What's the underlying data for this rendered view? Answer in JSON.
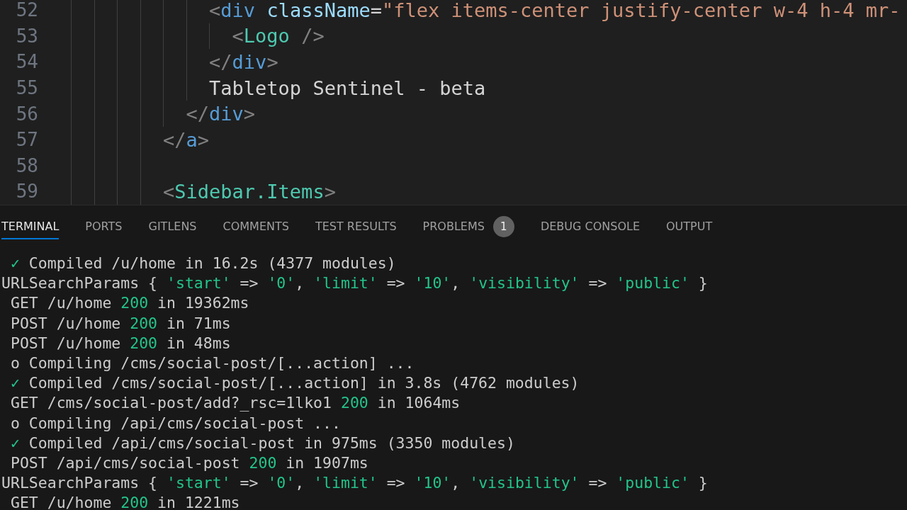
{
  "editor": {
    "lines": [
      {
        "number": "52",
        "tokens": [
          {
            "kind": "bracket",
            "text": "            <"
          },
          {
            "kind": "tag",
            "text": "div"
          },
          {
            "kind": "attr",
            "text": " className"
          },
          {
            "kind": "text",
            "text": "="
          },
          {
            "kind": "string",
            "text": "\"flex items-center justify-center w-4 h-4 mr-"
          }
        ]
      },
      {
        "number": "53",
        "tokens": [
          {
            "kind": "bracket",
            "text": "              <"
          },
          {
            "kind": "component",
            "text": "Logo"
          },
          {
            "kind": "bracket",
            "text": " />"
          }
        ]
      },
      {
        "number": "54",
        "tokens": [
          {
            "kind": "bracket",
            "text": "            </"
          },
          {
            "kind": "tag",
            "text": "div"
          },
          {
            "kind": "bracket",
            "text": ">"
          }
        ]
      },
      {
        "number": "55",
        "tokens": [
          {
            "kind": "text",
            "text": "            Tabletop Sentinel - beta"
          }
        ]
      },
      {
        "number": "56",
        "tokens": [
          {
            "kind": "bracket",
            "text": "          </"
          },
          {
            "kind": "tag",
            "text": "div"
          },
          {
            "kind": "bracket",
            "text": ">"
          }
        ]
      },
      {
        "number": "57",
        "tokens": [
          {
            "kind": "bracket",
            "text": "        </"
          },
          {
            "kind": "tag",
            "text": "a"
          },
          {
            "kind": "bracket",
            "text": ">"
          }
        ]
      },
      {
        "number": "58"
      },
      {
        "number": "59",
        "tokens": [
          {
            "kind": "bracket",
            "text": "        <"
          },
          {
            "kind": "component",
            "text": "Sidebar.Items"
          },
          {
            "kind": "bracket",
            "text": ">"
          }
        ]
      }
    ]
  },
  "panel_tabs": [
    {
      "label": "TERMINAL",
      "selected": true
    },
    {
      "label": "PORTS",
      "selected": false
    },
    {
      "label": "GITLENS",
      "selected": false
    },
    {
      "label": "COMMENTS",
      "selected": false
    },
    {
      "label": "TEST RESULTS",
      "selected": false
    },
    {
      "label": "PROBLEMS",
      "selected": false,
      "badge": "1"
    },
    {
      "label": "DEBUG CONSOLE",
      "selected": false
    },
    {
      "label": "OUTPUT",
      "selected": false
    }
  ],
  "terminal": {
    "lines": [
      [
        {
          "kind": "check",
          "text": " ✓"
        },
        {
          "kind": "text",
          "text": " Compiled /u/home in 16.2s (4377 modules)"
        }
      ],
      [
        {
          "kind": "text",
          "text": "URLSearchParams { "
        },
        {
          "kind": "string",
          "text": "'start'"
        },
        {
          "kind": "text",
          "text": " => "
        },
        {
          "kind": "string",
          "text": "'0'"
        },
        {
          "kind": "text",
          "text": ", "
        },
        {
          "kind": "string",
          "text": "'limit'"
        },
        {
          "kind": "text",
          "text": " => "
        },
        {
          "kind": "string",
          "text": "'10'"
        },
        {
          "kind": "text",
          "text": ", "
        },
        {
          "kind": "string",
          "text": "'visibility'"
        },
        {
          "kind": "text",
          "text": " => "
        },
        {
          "kind": "string",
          "text": "'public'"
        },
        {
          "kind": "text",
          "text": " }"
        }
      ],
      [
        {
          "kind": "text",
          "text": " GET /u/home "
        },
        {
          "kind": "string",
          "text": "200"
        },
        {
          "kind": "text",
          "text": " in 19362ms"
        }
      ],
      [
        {
          "kind": "text",
          "text": " POST /u/home "
        },
        {
          "kind": "string",
          "text": "200"
        },
        {
          "kind": "text",
          "text": " in 71ms"
        }
      ],
      [
        {
          "kind": "text",
          "text": " POST /u/home "
        },
        {
          "kind": "string",
          "text": "200"
        },
        {
          "kind": "text",
          "text": " in 48ms"
        }
      ],
      [
        {
          "kind": "text",
          "text": " o Compiling /cms/social-post/[...action] ..."
        }
      ],
      [
        {
          "kind": "check",
          "text": " ✓"
        },
        {
          "kind": "text",
          "text": " Compiled /cms/social-post/[...action] in 3.8s (4762 modules)"
        }
      ],
      [
        {
          "kind": "text",
          "text": " GET /cms/social-post/add?_rsc=1lko1 "
        },
        {
          "kind": "string",
          "text": "200"
        },
        {
          "kind": "text",
          "text": " in 1064ms"
        }
      ],
      [
        {
          "kind": "text",
          "text": " o Compiling /api/cms/social-post ..."
        }
      ],
      [
        {
          "kind": "check",
          "text": " ✓"
        },
        {
          "kind": "text",
          "text": " Compiled /api/cms/social-post in 975ms (3350 modules)"
        }
      ],
      [
        {
          "kind": "text",
          "text": " POST /api/cms/social-post "
        },
        {
          "kind": "string",
          "text": "200"
        },
        {
          "kind": "text",
          "text": " in 1907ms"
        }
      ],
      [
        {
          "kind": "text",
          "text": "URLSearchParams { "
        },
        {
          "kind": "string",
          "text": "'start'"
        },
        {
          "kind": "text",
          "text": " => "
        },
        {
          "kind": "string",
          "text": "'0'"
        },
        {
          "kind": "text",
          "text": ", "
        },
        {
          "kind": "string",
          "text": "'limit'"
        },
        {
          "kind": "text",
          "text": " => "
        },
        {
          "kind": "string",
          "text": "'10'"
        },
        {
          "kind": "text",
          "text": ", "
        },
        {
          "kind": "string",
          "text": "'visibility'"
        },
        {
          "kind": "text",
          "text": " => "
        },
        {
          "kind": "string",
          "text": "'public'"
        },
        {
          "kind": "text",
          "text": " }"
        }
      ],
      [
        {
          "kind": "text",
          "text": " GET /u/home "
        },
        {
          "kind": "string",
          "text": "200"
        },
        {
          "kind": "text",
          "text": " in 1221ms"
        }
      ]
    ]
  }
}
